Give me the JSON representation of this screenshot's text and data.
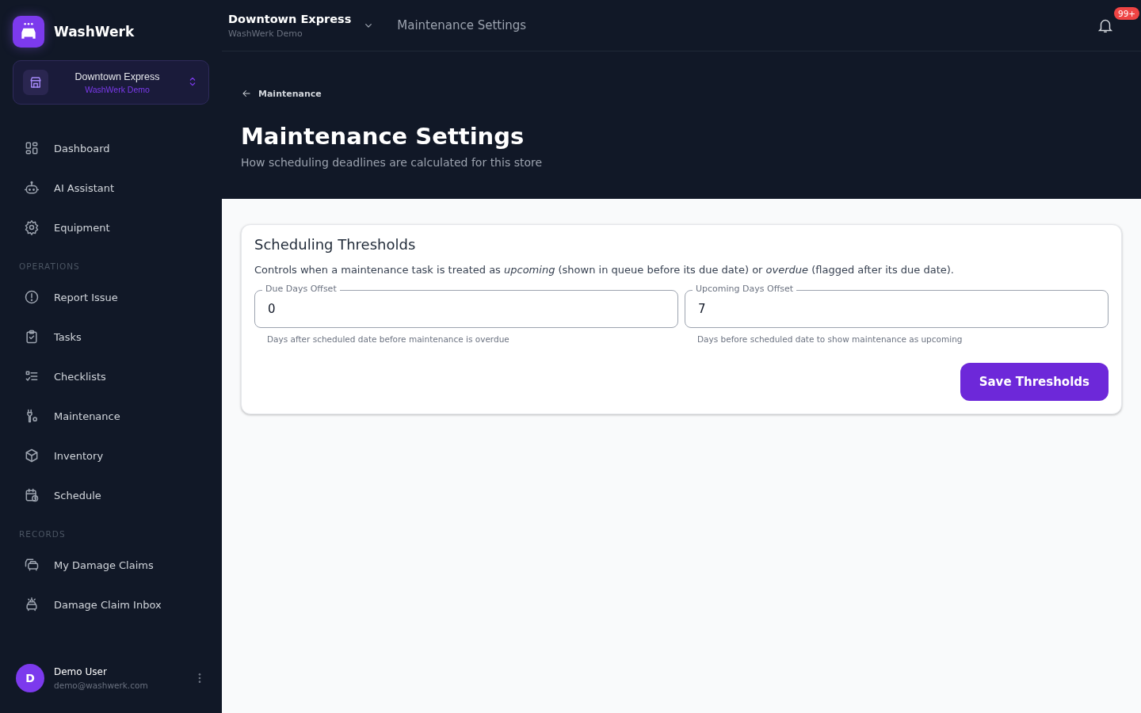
{
  "brand": {
    "name": "WashWerk"
  },
  "store_switcher": {
    "name": "Downtown Express",
    "org": "WashWerk Demo"
  },
  "nav": [
    {
      "label": "Dashboard",
      "selected": false
    },
    {
      "label": "AI Assistant",
      "selected": false
    },
    {
      "label": "Equipment",
      "selected": false
    },
    {
      "section": "OPERATIONS"
    },
    {
      "label": "Report Issue",
      "selected": false
    },
    {
      "label": "Tasks",
      "selected": false
    },
    {
      "label": "Checklists",
      "selected": false
    },
    {
      "label": "Maintenance",
      "selected": false
    },
    {
      "label": "Inventory",
      "selected": false
    },
    {
      "label": "Schedule",
      "selected": false
    },
    {
      "section": "RECORDS"
    },
    {
      "label": "My Damage Claims",
      "selected": false
    },
    {
      "label": "Damage Claim Inbox",
      "selected": false
    }
  ],
  "user": {
    "initial": "D",
    "name": "Demo User",
    "email": "demo@washwerk.com"
  },
  "topbar": {
    "store": "Downtown Express",
    "org": "WashWerk Demo",
    "title": "Maintenance Settings",
    "notifications": "99+"
  },
  "header": {
    "back": "Maintenance",
    "title": "Maintenance Settings",
    "subtitle": "How scheduling deadlines are calculated for this store"
  },
  "card": {
    "title": "Scheduling Thresholds",
    "description": "Controls when a maintenance task is treated as *upcoming* (shown in queue before its due date) or *overdue* (flagged after its due date).",
    "fields": [
      {
        "label": "Due Days Offset",
        "value": "0",
        "helper": "Days after scheduled date before maintenance is overdue"
      },
      {
        "label": "Upcoming Days Offset",
        "value": "7",
        "helper": "Days before scheduled date to show maintenance as upcoming"
      }
    ],
    "button": "Save Thresholds"
  }
}
